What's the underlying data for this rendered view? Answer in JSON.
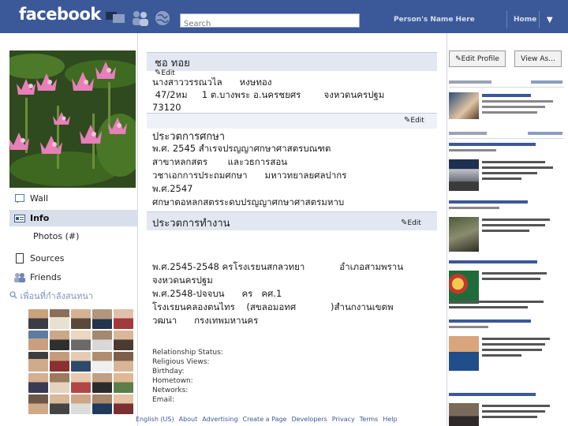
{
  "brand": "facebook",
  "top_bar": {
    "search_placeholder": "Search",
    "user_name": "Person's Name Here",
    "home": "Home",
    "menu_caret": "▼"
  },
  "colors": {
    "brand_blue": "#3b5998",
    "section_bg": "#e2e7f1",
    "nav_active": "#d8dfea"
  },
  "sidebar": {
    "items": [
      {
        "label": "Wall",
        "icon": "wall-icon"
      },
      {
        "label": "Info",
        "icon": "info-icon",
        "active": true
      },
      {
        "label": "Photos (#)",
        "icon": ""
      },
      {
        "label": "Sources",
        "icon": "page-icon"
      },
      {
        "label": "Friends",
        "icon": "friends-icon"
      }
    ],
    "friends_title": "เพื่อนที่กำลังสนทนา"
  },
  "profile": {
    "section_title": "ชอ  ทอย",
    "edit_label": "Edit",
    "lines": [
      "นางสาววรรณวไล      หงษทอง",
      " 47/2หม     1 ต.บางพระ อ.นครชยศร        จงหวดนครปฐม",
      "73120"
    ]
  },
  "education": {
    "section_title": "ประวตการศกษา",
    "edit_label": "Edit",
    "lines": [
      "พ.ศ. 2545 สำเรจปรญญาศกษาศาสตรบณฑต",
      "สาขาหลกสตร       และวธการสอน",
      "วชาเอกการประถมศกษา      มหาวทยาลยศลปากร",
      "พ.ศ.2547",
      "ศกษาตอหลกสตรระดบปรญญาศกษาศาสตรมหาบ"
    ]
  },
  "work": {
    "section_title": "ประวตการทำงาน",
    "edit_label": "Edit",
    "lines": [
      "พ.ศ.2545-2548 ครโรงเรยนสกลวทยา            อำเภอสามพราน",
      "จงหวดนครปฐม",
      "พ.ศ.2548-ปจจบน      คร   คศ.1",
      "โรงเรยนคลองตนไทร    (สขลอมอทศ            )สำนกงานเขตพ",
      "วฒนา      กรงเทพมหานคร"
    ]
  },
  "details": [
    "Relationship Status:",
    "Religious Views:",
    "Birthday:",
    "Hometown:",
    "Networks:",
    "Email:"
  ],
  "footer": {
    "language": "English (US)",
    "links": [
      "About",
      "Advertising",
      "Create a Page",
      "Developers",
      "Privacy",
      "Terms",
      "Help"
    ]
  },
  "right": {
    "edit_profile": "Edit  Profile",
    "view_as": "View As..."
  }
}
